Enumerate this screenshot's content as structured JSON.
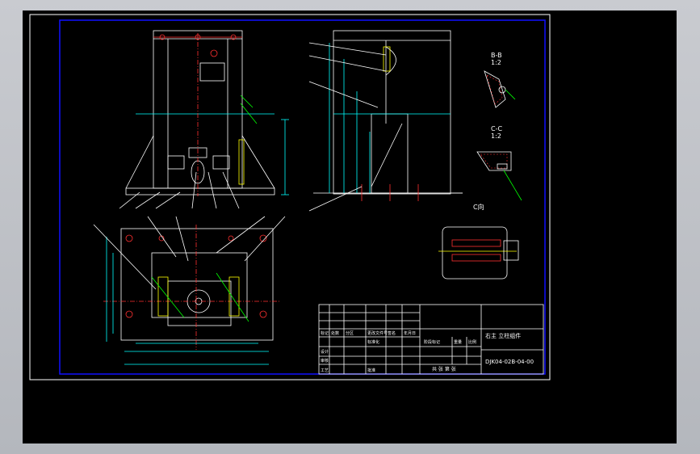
{
  "drawing": {
    "title_block": {
      "part_name": "右主 立柱组件",
      "drawing_number": "DJK04-02B-04-00",
      "row_labels": [
        "标记",
        "设计",
        "审核",
        "工艺"
      ],
      "header_cells": [
        "处数",
        "分区",
        "更改文件号",
        "签名",
        "年月日"
      ],
      "stage_label": "阶段标记",
      "weight_label": "重量",
      "scale_label": "比例",
      "sheet_label": "共 张 第 张",
      "standard_label": "标准化",
      "approve_label": "批准"
    },
    "section_labels": {
      "bb": "B-B",
      "bb_scale": "1:2",
      "cc": "C-C",
      "cc_scale": "1:2",
      "c_view": "C向"
    },
    "colors": {
      "background": "#000000",
      "frame": "#ffffff",
      "border": "#0000ff",
      "geometry": "#ffffff",
      "dimension": "#00ffff",
      "centerline": "#ff0000",
      "hatch": "#ffff00",
      "leader": "#00ff00",
      "accent": "#ff00ff"
    }
  }
}
